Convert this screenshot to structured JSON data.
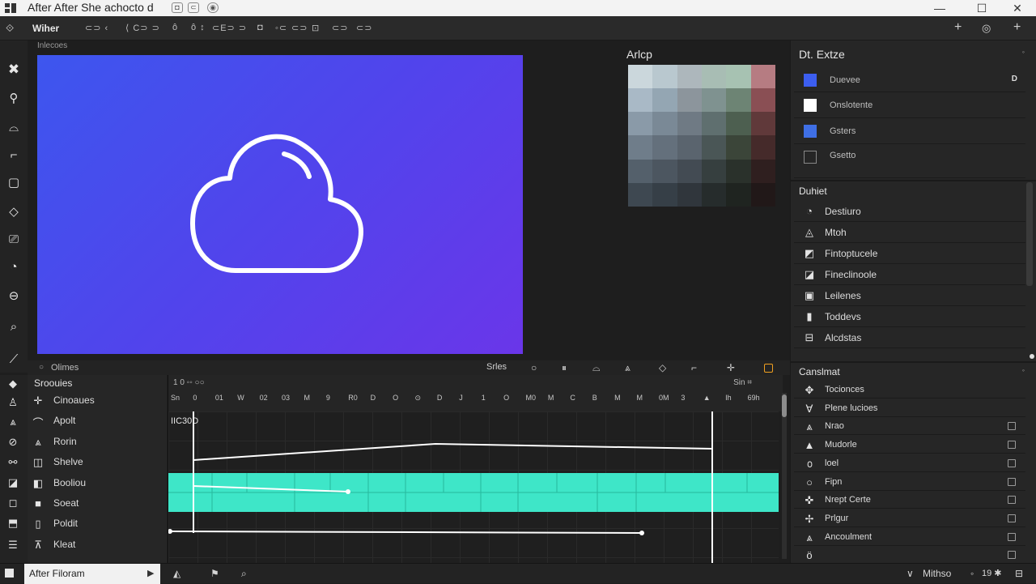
{
  "window": {
    "title": "After After  She achocto d",
    "controls": [
      "—",
      "☐",
      "✕"
    ]
  },
  "toolbar": {
    "workspace": "Wiher",
    "tools": [
      "⊂⊃ ‹",
      "⟨ C⊃ ⊃",
      "ô",
      "ô ↕",
      "⊂E⊃ ⊃",
      "◘",
      "◦⊂",
      "⊂⊃",
      "⊡",
      "⊂⊃",
      "⊂⊃"
    ]
  },
  "viewer": {
    "label": "Inlecoes"
  },
  "swatches": {
    "title": "Arlcp",
    "colors": [
      [
        "#cbd7dc",
        "#b9c8cf",
        "#adb7bc",
        "#a8bdb4",
        "#a7c2b2",
        "#b67c82"
      ],
      [
        "#a9b9c6",
        "#94a6b3",
        "#8c959c",
        "#7f9290",
        "#6d8474",
        "#8a4f54"
      ],
      [
        "#8a9aa8",
        "#7a8996",
        "#6f7a84",
        "#5f6f6f",
        "#4d5f50",
        "#60393a"
      ],
      [
        "#6f7d8a",
        "#64707c",
        "#5a646e",
        "#4a5656",
        "#3b4539",
        "#452a2a"
      ],
      [
        "#54606b",
        "#4c5660",
        "#434b53",
        "#363f3f",
        "#2a312b",
        "#2f1f1f"
      ],
      [
        "#3e4851",
        "#363f47",
        "#30363c",
        "#262c2c",
        "#1f2420",
        "#211818"
      ]
    ]
  },
  "effects": {
    "title": "Dt.  Extze",
    "items": [
      {
        "label": "Duevee",
        "color": "#3c5ef0",
        "mark": "D"
      },
      {
        "label": "Onslotente",
        "color": "#ffffff",
        "mark": ""
      },
      {
        "label": "Gsters",
        "color": "#3f6fe5",
        "mark": ""
      },
      {
        "label": "Gsetto",
        "color": "",
        "mark": ""
      }
    ]
  },
  "presets": {
    "title": "Duhiet",
    "items": [
      {
        "icon": "◔",
        "label": "Destiuro"
      },
      {
        "icon": "◬",
        "label": "Mtoh"
      },
      {
        "icon": "◩",
        "label": "Fintoptucele"
      },
      {
        "icon": "◪",
        "label": "Fineclinoole"
      },
      {
        "icon": "▣",
        "label": "Leilenes"
      },
      {
        "icon": "▮",
        "label": "Toddevs"
      },
      {
        "icon": "⊟",
        "label": "Alcdstas"
      }
    ]
  },
  "properties": {
    "title": "Canslmat",
    "items": [
      {
        "icon": "✥",
        "label": "Tocionces"
      },
      {
        "icon": "∀",
        "label": "Plene lucioes"
      },
      {
        "icon": "⩓",
        "label": "Nrao"
      },
      {
        "icon": "▲",
        "label": "Mudorle"
      },
      {
        "icon": "൦",
        "label": "loel"
      },
      {
        "icon": "○",
        "label": "Fipn"
      },
      {
        "icon": "✜",
        "label": "Nrept Certe"
      },
      {
        "icon": "✢",
        "label": "Prlgur"
      },
      {
        "icon": "⩓",
        "label": "Ancoulment"
      },
      {
        "icon": "ö",
        "label": ""
      }
    ]
  },
  "timeline": {
    "label": "Olimes",
    "controls_label": "Srles",
    "layers_title": "Sroouies",
    "layers": [
      {
        "icon": "✛",
        "label": "Cinoaues"
      },
      {
        "icon": "⌒",
        "label": "Apolt"
      },
      {
        "icon": "⩓",
        "label": "Rorin"
      },
      {
        "icon": "◫",
        "label": "Shelve"
      },
      {
        "icon": "◧",
        "label": "Booliou"
      },
      {
        "icon": "■",
        "label": "Soeat"
      },
      {
        "icon": "▯",
        "label": "Poldit"
      },
      {
        "icon": "⊼",
        "label": "Kleat"
      }
    ],
    "ruler_top_left": "1 0  ◦◦  ○○",
    "ruler_top_right": "Sin  ⌗",
    "ruler_marks": [
      "Sn",
      "0",
      "01",
      "W",
      "02",
      "03",
      "M",
      "9",
      "R0",
      "D",
      "O",
      "⊙",
      "D",
      "J",
      "1",
      "O",
      "M0",
      "M",
      "C",
      "B",
      "M",
      "M",
      "0M",
      "3",
      "▲",
      "Ih",
      "69h"
    ],
    "current_time": "IIC30D"
  },
  "statusbar": {
    "field": "After Filoram",
    "zoom": "Mithso",
    "page": "19 ✱",
    "chevron": "∨"
  },
  "colors": {
    "accent": "#3ee6c8",
    "canvas_start": "#3d56ee",
    "canvas_end": "#6a36e9",
    "panel": "#262626"
  }
}
